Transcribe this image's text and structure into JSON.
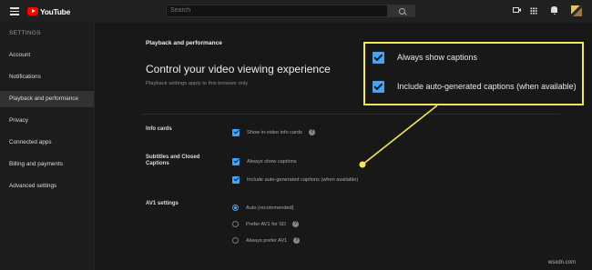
{
  "header": {
    "logo_text": "YouTube",
    "search_placeholder": "Search",
    "icons": [
      "menu-icon",
      "search-icon",
      "video-camera-icon",
      "apps-icon",
      "bell-icon"
    ]
  },
  "sidebar": {
    "heading": "SETTINGS",
    "items": [
      {
        "label": "Account",
        "active": false
      },
      {
        "label": "Notifications",
        "active": false
      },
      {
        "label": "Playback and performance",
        "active": true
      },
      {
        "label": "Privacy",
        "active": false
      },
      {
        "label": "Connected apps",
        "active": false
      },
      {
        "label": "Billing and payments",
        "active": false
      },
      {
        "label": "Advanced settings",
        "active": false
      }
    ]
  },
  "main": {
    "title": "Playback and performance",
    "heading": "Control your video viewing experience",
    "subtitle": "Playback settings apply to this browser only",
    "sections": {
      "info_cards": {
        "label": "Info cards",
        "options": [
          {
            "label": "Show in-video info cards",
            "checked": true
          }
        ]
      },
      "subtitles": {
        "label": "Subtitles and Closed Captions",
        "options": [
          {
            "label": "Always show captions",
            "checked": true
          },
          {
            "label": "Include auto-generated captions (when available)",
            "checked": true
          }
        ]
      },
      "av1": {
        "label": "AV1 settings",
        "options": [
          {
            "label": "Auto (recommended)",
            "selected": true
          },
          {
            "label": "Prefer AV1 for SD",
            "selected": false
          },
          {
            "label": "Always prefer AV1",
            "selected": false
          }
        ]
      }
    }
  },
  "callout": {
    "items": [
      {
        "label": "Always show captions",
        "checked": true
      },
      {
        "label": "Include auto-generated captions (when available)",
        "checked": true
      }
    ],
    "border_color": "#f5e65a"
  },
  "help_glyph": "?",
  "watermark": "wsxdn.com",
  "colors": {
    "accent": "#3ea6ff",
    "brand": "#ff0000",
    "background": "#181818"
  }
}
